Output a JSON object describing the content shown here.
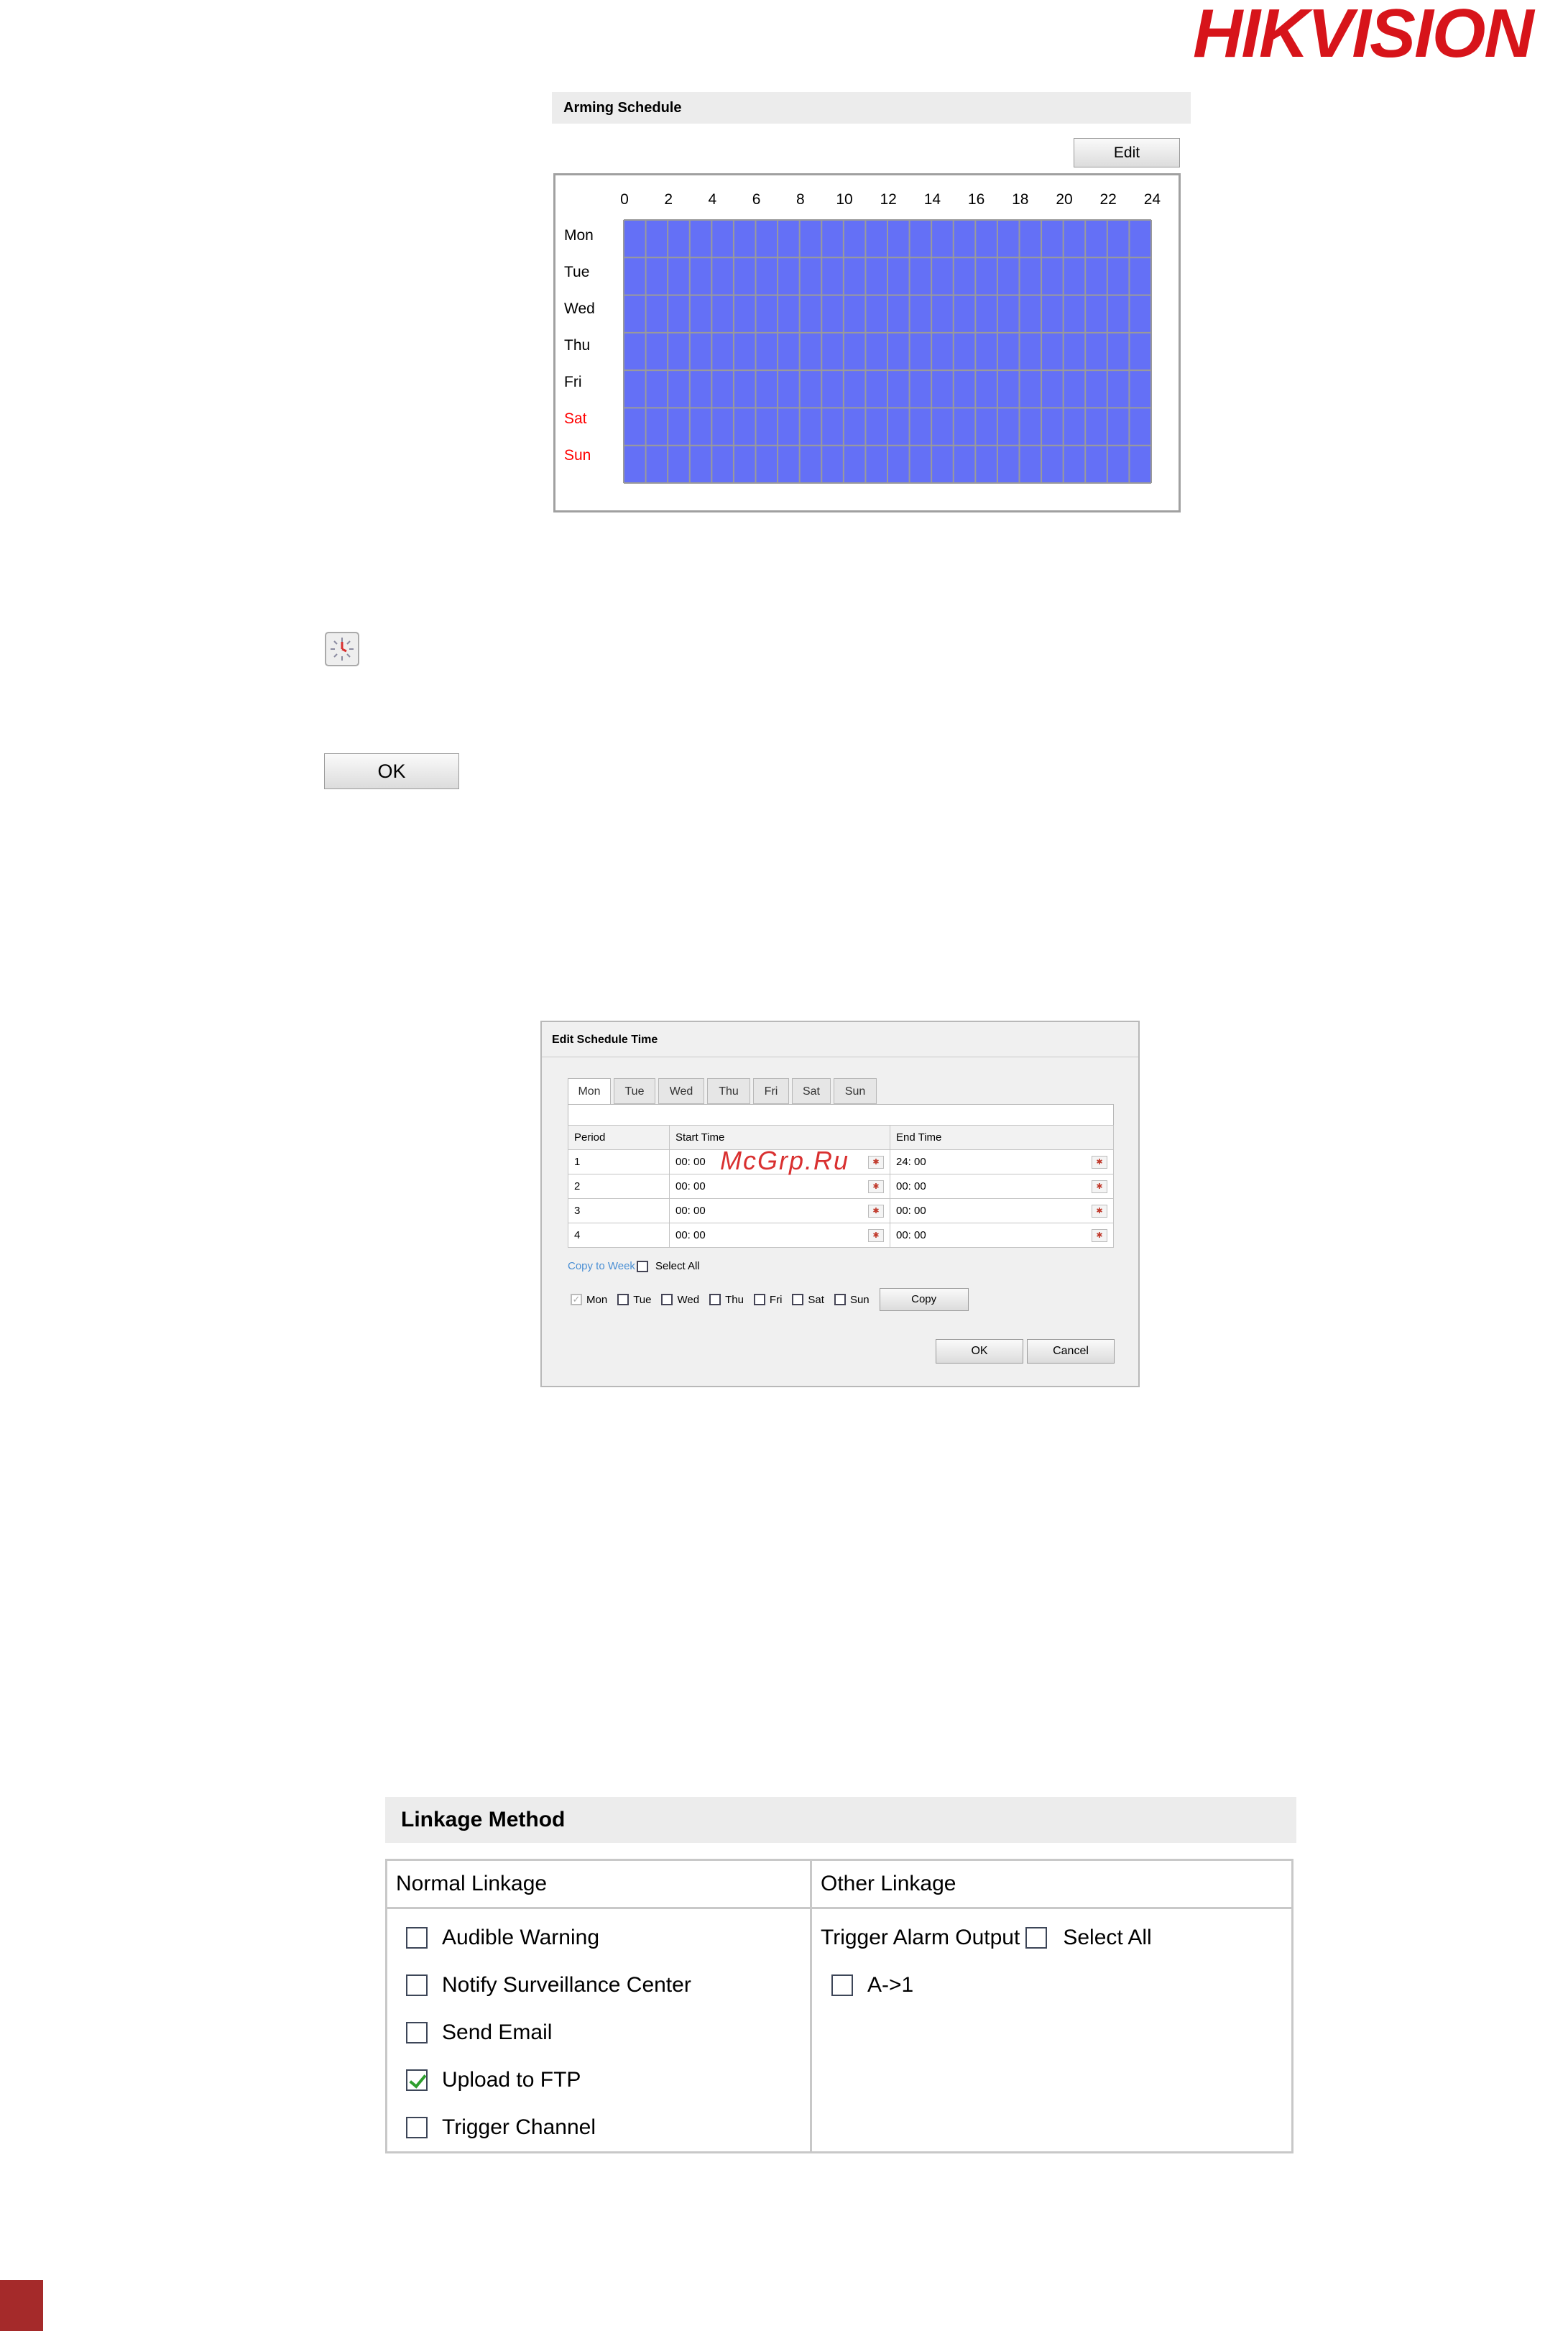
{
  "brand": {
    "logo_text": "HIKVISION",
    "color": "#d7141a"
  },
  "arming_schedule": {
    "title": "Arming Schedule",
    "edit_label": "Edit",
    "hours": [
      "0",
      "2",
      "4",
      "6",
      "8",
      "10",
      "12",
      "14",
      "16",
      "18",
      "20",
      "22",
      "24"
    ],
    "days": [
      "Mon",
      "Tue",
      "Wed",
      "Thu",
      "Fri",
      "Sat",
      "Sun"
    ],
    "weekend_color": "#ff0000",
    "fill_color": "#6470f6",
    "armed_hours_per_day": [
      24,
      24,
      24,
      24,
      24,
      24,
      24
    ]
  },
  "icons": {
    "clock": "time-picker-icon"
  },
  "ok_button": {
    "label": "OK"
  },
  "edit_dialog": {
    "title": "Edit Schedule Time",
    "tabs": [
      "Mon",
      "Tue",
      "Wed",
      "Thu",
      "Fri",
      "Sat",
      "Sun"
    ],
    "active_tab": "Mon",
    "columns": [
      "Period",
      "Start Time",
      "End Time"
    ],
    "rows": [
      {
        "period": "1",
        "start": "00: 00",
        "end": "24: 00"
      },
      {
        "period": "2",
        "start": "00: 00",
        "end": "00: 00"
      },
      {
        "period": "3",
        "start": "00: 00",
        "end": "00: 00"
      },
      {
        "period": "4",
        "start": "00: 00",
        "end": "00: 00"
      }
    ],
    "copy_to_week": "Copy to Week",
    "select_all": "Select All",
    "day_checks": [
      {
        "label": "Mon",
        "checked": true
      },
      {
        "label": "Tue",
        "checked": false
      },
      {
        "label": "Wed",
        "checked": false
      },
      {
        "label": "Thu",
        "checked": false
      },
      {
        "label": "Fri",
        "checked": false
      },
      {
        "label": "Sat",
        "checked": false
      },
      {
        "label": "Sun",
        "checked": false
      }
    ],
    "copy_label": "Copy",
    "ok_label": "OK",
    "cancel_label": "Cancel",
    "watermark": "McGrp.Ru"
  },
  "linkage": {
    "title": "Linkage Method",
    "normal_header": "Normal Linkage",
    "other_header": "Other Linkage",
    "normal_items": [
      {
        "label": "Audible Warning",
        "checked": false
      },
      {
        "label": "Notify Surveillance Center",
        "checked": false
      },
      {
        "label": "Send Email",
        "checked": false
      },
      {
        "label": "Upload to FTP",
        "checked": true
      },
      {
        "label": "Trigger Channel",
        "checked": false
      }
    ],
    "trigger_alarm_output": "Trigger Alarm Output",
    "select_all": "Select All",
    "alarm_outputs": [
      {
        "label": "A->1",
        "checked": false
      }
    ]
  }
}
